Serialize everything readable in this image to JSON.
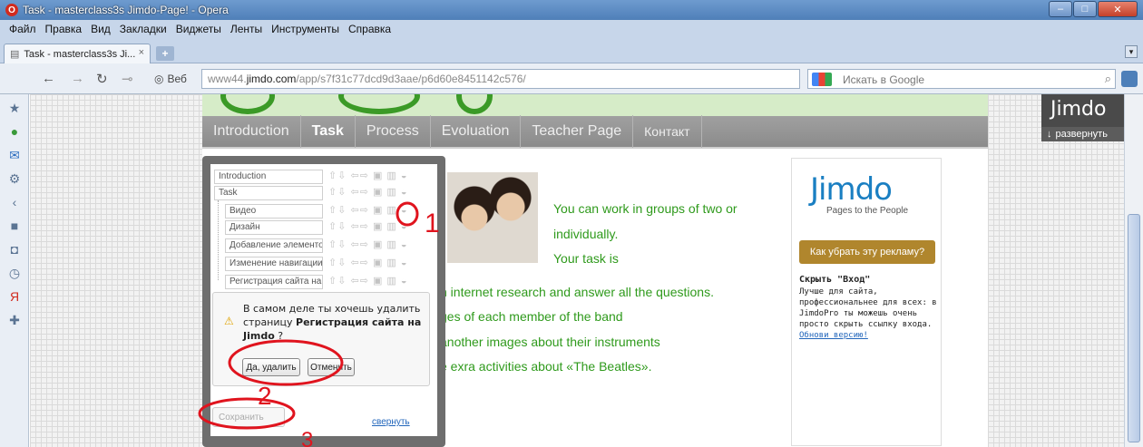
{
  "window": {
    "title": "Task - masterclass3s Jimdo-Page! - Opera",
    "minimize": "–",
    "maximize": "□",
    "close": "✕"
  },
  "menubar": {
    "items": [
      "Файл",
      "Правка",
      "Вид",
      "Закладки",
      "Виджеты",
      "Ленты",
      "Инструменты",
      "Справка"
    ]
  },
  "tabs": {
    "active_label": "Task - masterclass3s Ji...",
    "close": "×",
    "new_tab": "+"
  },
  "navbar": {
    "web_label": "Веб",
    "url_domain": "www44.",
    "url_host": "jimdo.com",
    "url_path": "/app/s7f31c77dcd9d3aae/p6d60e8451142c576/",
    "search_placeholder": "Искать в Google"
  },
  "site": {
    "nav": [
      "Introduction",
      "Task",
      "Process",
      "Evoluation",
      "Teacher Page",
      "Контакт"
    ],
    "active_nav": "Task",
    "content_lines": [
      "You can  work in groups of two or",
      "individually.",
      "Your task is",
      "n internet research and answer all the questions.",
      "ges of each member of the band",
      "another images about their instruments",
      "e exra activities about «The Beatles»."
    ]
  },
  "sidebar_ad": {
    "logo": "Jimdo",
    "tagline": "Pages to the People",
    "remove_ads": "Как убрать эту рекламу?",
    "hide_title": "Скрыть \"Вход\"",
    "hide_text": "Лучше для сайта, профессиональнее для всех: в JimdoPro ты можешь очень просто скрыть ссылку входа.",
    "hide_link": "Обнови версию!"
  },
  "jimdo_badge": {
    "logo": "Jimdo",
    "expand": "развернуть"
  },
  "nav_editor": {
    "rows": [
      "Introduction",
      "Task",
      "Видео",
      "Дизайн",
      "Добавление элементов",
      "Изменение навигации",
      "Регистрация сайта на Jimdo"
    ],
    "confirm_text_1": "В самом деле ты хочешь удалить страницу ",
    "confirm_text_bold": "Регистрация сайта на Jimdo",
    "confirm_text_2": " ?",
    "confirm_yes": "Да, удалить",
    "confirm_cancel": "Отменить",
    "save": "Сохранить",
    "collapse": "свернуть"
  },
  "annotations": {
    "num1": "1",
    "num2": "2",
    "num3": "3",
    "color": "#e0141e"
  }
}
